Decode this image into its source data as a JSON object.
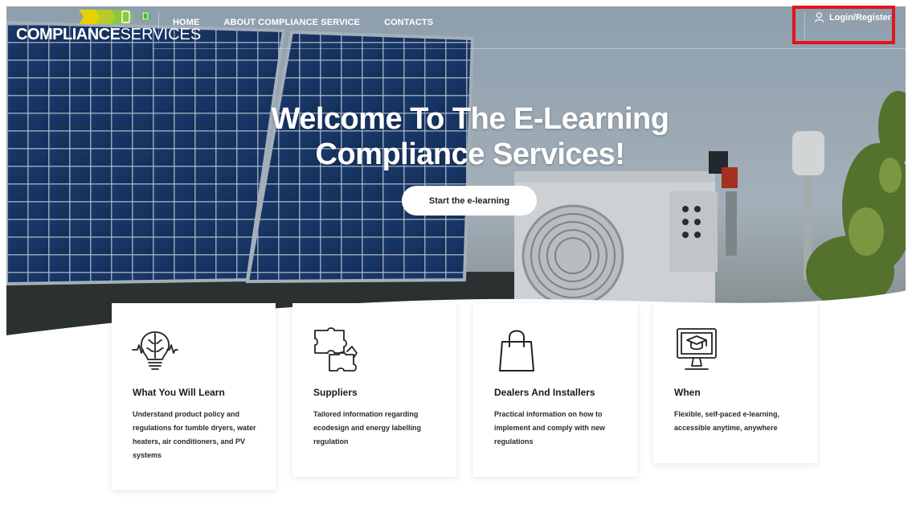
{
  "brand": {
    "logo_bold": "COMPLIANCE",
    "logo_light": "SERVICES",
    "colors": {
      "yellow": "#e6d200",
      "green": "#4bb543",
      "accent_red": "#e3141b"
    }
  },
  "nav": {
    "items": [
      {
        "label": "HOME"
      },
      {
        "label": "ABOUT COMPLIANCE SERVICE"
      },
      {
        "label": "CONTACTS"
      }
    ],
    "login_label": "Login/Register",
    "icons": {
      "login": "user-icon",
      "search": "search-icon"
    }
  },
  "hero": {
    "title_line1": "Welcome To The E-Learning",
    "title_line2": "Compliance Services!",
    "cta_label": "Start the e-learning"
  },
  "cards": [
    {
      "icon": "lightbulb-brain-icon",
      "title": "What You Will Learn",
      "text": "Understand product policy and regulations for tumble dryers, water heaters, air conditioners, and PV systems"
    },
    {
      "icon": "puzzle-icon",
      "title": "Suppliers",
      "text": "Tailored information regarding ecodesign and energy labelling regulation"
    },
    {
      "icon": "shopping-bag-icon",
      "title": "Dealers And Installers",
      "text": "Practical information on how to implement and comply with new regulations"
    },
    {
      "icon": "computer-graduation-icon",
      "title": "When",
      "text": "Flexible, self-paced e-learning, accessible anytime, anywhere"
    }
  ]
}
